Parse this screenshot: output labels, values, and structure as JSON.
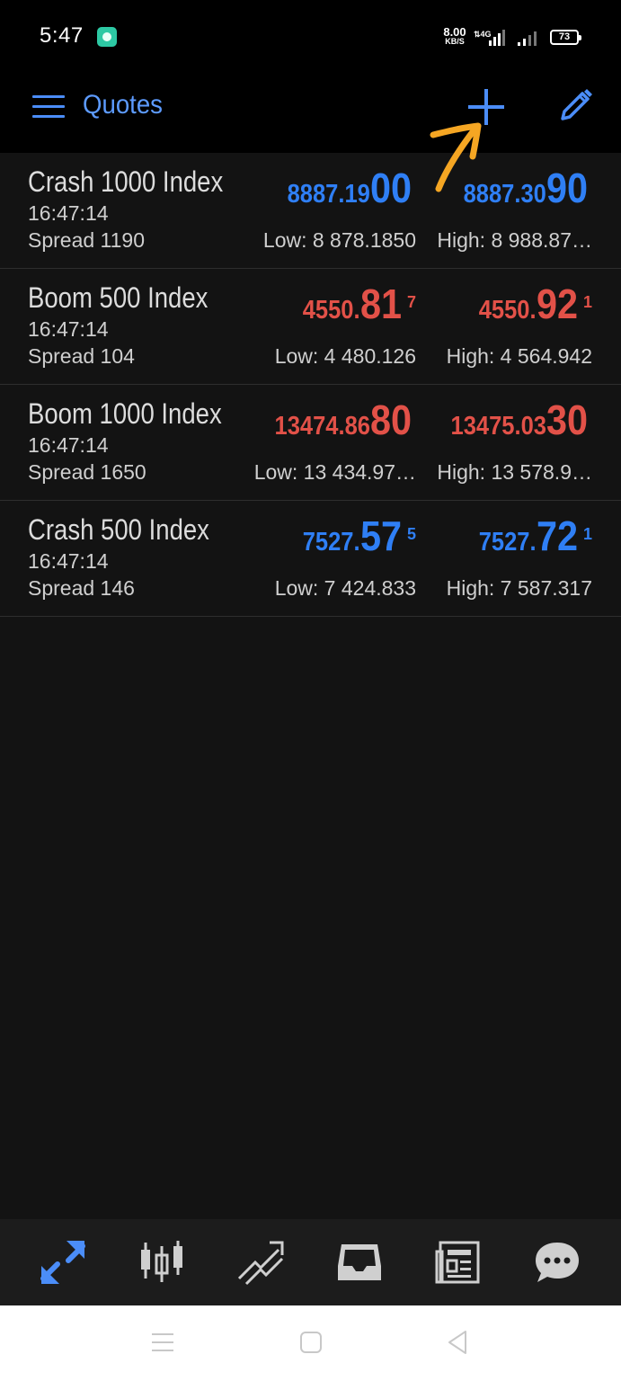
{
  "status_bar": {
    "time": "5:47",
    "net_speed_value": "8.00",
    "net_speed_unit": "KB/S",
    "battery": "73"
  },
  "header": {
    "title": "Quotes",
    "menu_icon": "hamburger-menu-icon",
    "add_icon": "plus-icon",
    "edit_icon": "pencil-icon",
    "accent_color": "#4b8df8",
    "annotation_color": "#f5a623"
  },
  "quotes": [
    {
      "symbol": "Crash 1000 Index",
      "time": "16:47:14",
      "spread": "Spread 1190",
      "bid": {
        "main": "8887.19",
        "big": "00",
        "sup": ""
      },
      "ask": {
        "main": "8887.30",
        "big": "90",
        "sup": ""
      },
      "low": "Low: 8 878.1850",
      "high": "High: 8 988.87…",
      "color": "blue"
    },
    {
      "symbol": "Boom 500 Index",
      "time": "16:47:14",
      "spread": "Spread 104",
      "bid": {
        "main": "4550.",
        "big": "81",
        "sup": "7"
      },
      "ask": {
        "main": "4550.",
        "big": "92",
        "sup": "1"
      },
      "low": "Low: 4 480.126",
      "high": "High: 4 564.942",
      "color": "red"
    },
    {
      "symbol": "Boom 1000 Index",
      "time": "16:47:14",
      "spread": "Spread 1650",
      "bid": {
        "main": "13474.86",
        "big": "80",
        "sup": ""
      },
      "ask": {
        "main": "13475.03",
        "big": "30",
        "sup": ""
      },
      "low": "Low: 13 434.97…",
      "high": "High: 13 578.9…",
      "color": "red"
    },
    {
      "symbol": "Crash 500 Index",
      "time": "16:47:14",
      "spread": "Spread 146",
      "bid": {
        "main": "7527.",
        "big": "57",
        "sup": "5"
      },
      "ask": {
        "main": "7527.",
        "big": "72",
        "sup": "1"
      },
      "low": "Low: 7 424.833",
      "high": "High: 7 587.317",
      "color": "blue"
    }
  ],
  "bottom_nav": [
    {
      "name": "quotes-nav-icon",
      "active": true
    },
    {
      "name": "chart-nav-icon",
      "active": false
    },
    {
      "name": "trade-nav-icon",
      "active": false
    },
    {
      "name": "history-nav-icon",
      "active": false
    },
    {
      "name": "news-nav-icon",
      "active": false
    },
    {
      "name": "messages-nav-icon",
      "active": false
    }
  ],
  "system_nav": [
    "recent-apps-icon",
    "home-icon",
    "back-icon"
  ]
}
